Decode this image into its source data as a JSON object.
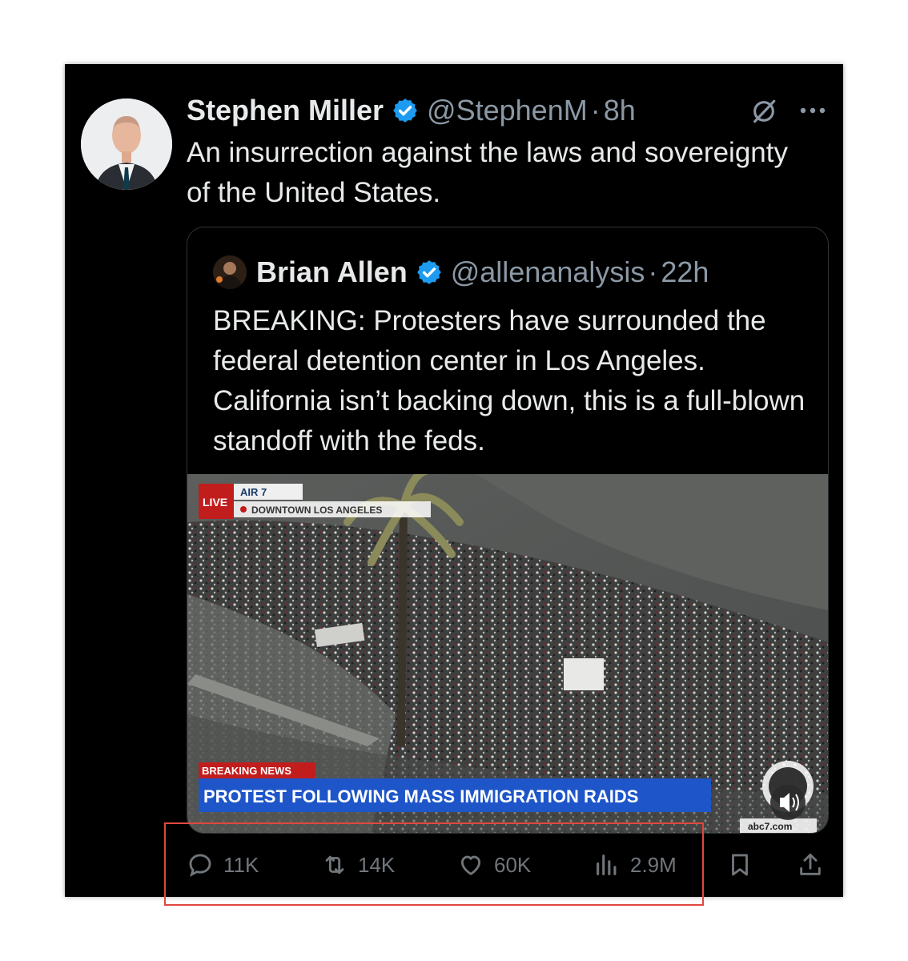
{
  "tweet": {
    "author_name": "Stephen Miller",
    "handle": "@StephenM",
    "separator": "·",
    "time": "8h",
    "text": "An insurrection against the laws and sovereignty of the United States."
  },
  "quoted_tweet": {
    "author_name": "Brian Allen",
    "handle": "@allenanalysis",
    "separator": "·",
    "time": "22h",
    "text": "BREAKING: Protesters have surrounded the federal detention center in Los Angeles. California isn’t backing down, this is a full-blown standoff with the feds.",
    "media": {
      "live_badge": "LIVE",
      "air_label": "AIR 7",
      "location": "DOWNTOWN LOS ANGELES",
      "breaking_label": "BREAKING NEWS",
      "headline": "PROTEST FOLLOWING MASS IMMIGRATION RAIDS",
      "station_site": "abc7.com"
    }
  },
  "actions": {
    "replies": "11K",
    "reposts": "14K",
    "likes": "60K",
    "views": "2.9M"
  },
  "colors": {
    "background": "#000000",
    "text": "#e7e9ea",
    "secondary": "#71767b",
    "verified": "#1d9bf0",
    "highlight": "#e0483e"
  },
  "icons": [
    "verified-badge-icon",
    "grok-icon",
    "more-icon",
    "reply-icon",
    "repost-icon",
    "like-icon",
    "views-icon",
    "bookmark-icon",
    "share-icon",
    "volume-icon"
  ]
}
